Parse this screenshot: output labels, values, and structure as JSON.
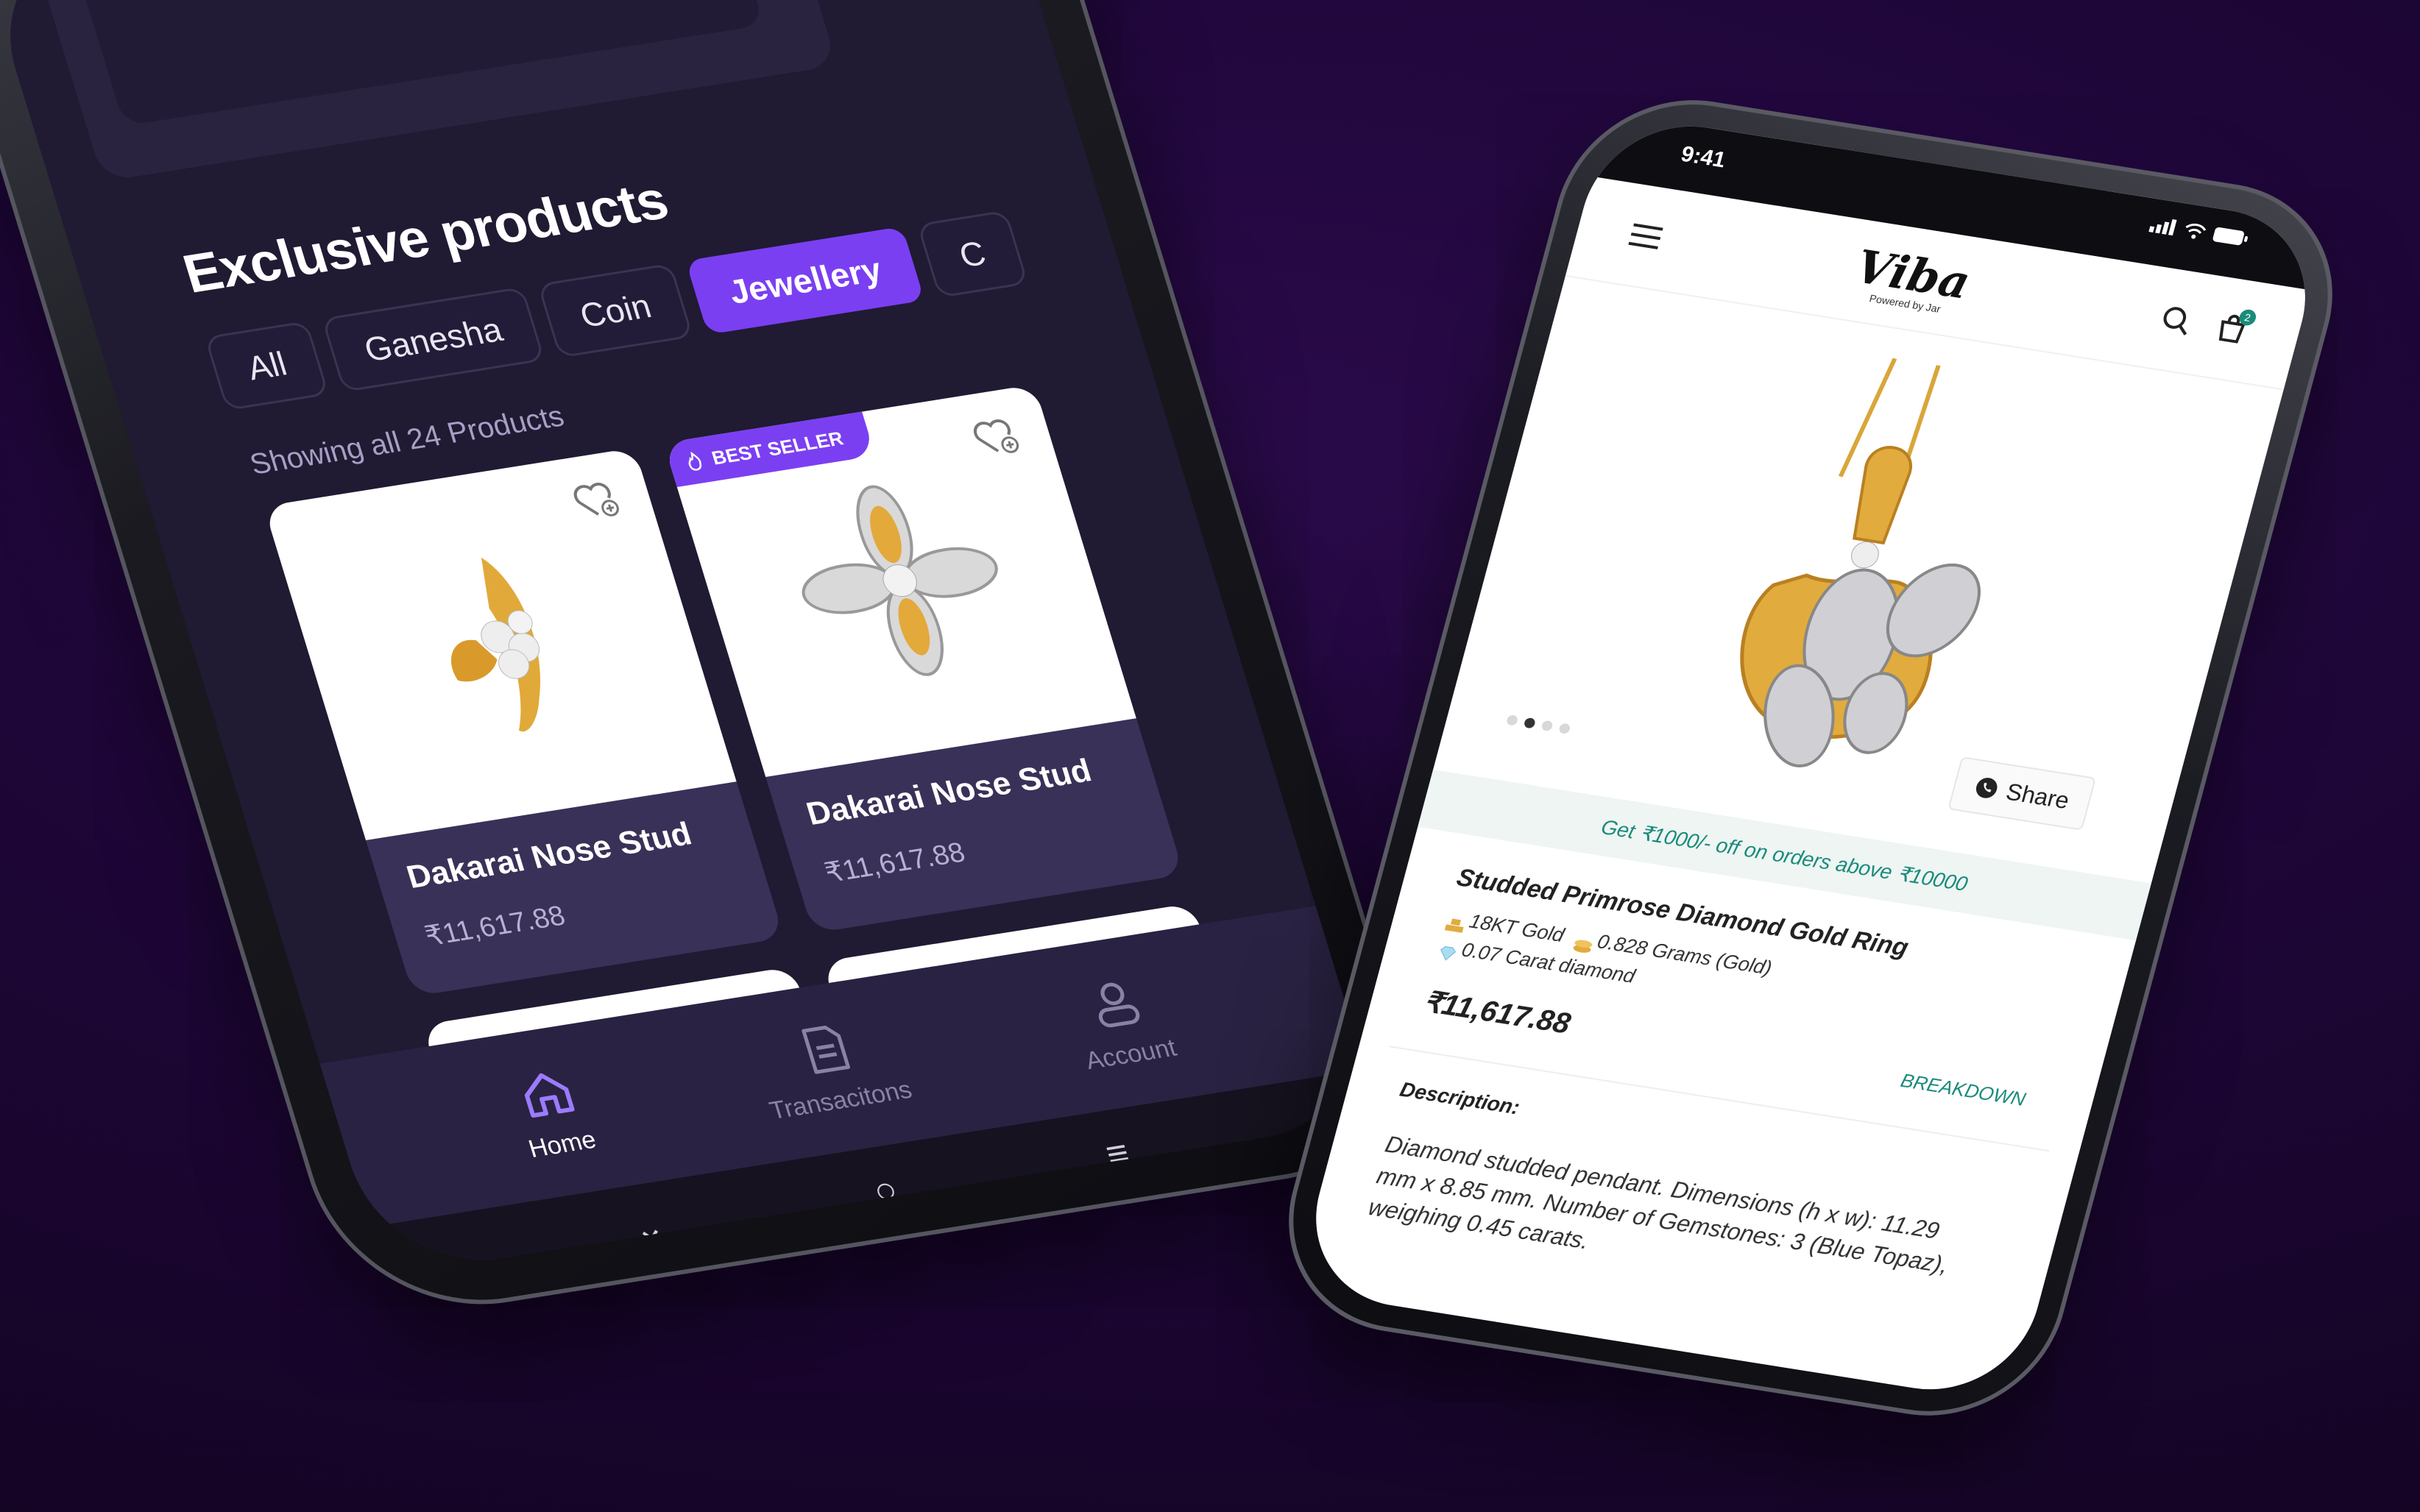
{
  "left_app": {
    "section_title": "Exclusive products",
    "tabs": [
      {
        "label": "All"
      },
      {
        "label": "Ganesha"
      },
      {
        "label": "Coin"
      },
      {
        "label": "Jewellery"
      },
      {
        "label": "C"
      }
    ],
    "active_tab": "Jewellery",
    "showing_text": "Showing all 24 Products",
    "products": [
      {
        "name": "Dakarai Nose Stud",
        "price": "₹11,617.88",
        "badge": ""
      },
      {
        "name": "Dakarai Nose Stud",
        "price": "₹11,617.88",
        "badge": "BEST SELLER"
      }
    ],
    "nav": [
      {
        "label": "Home",
        "icon": "home-icon"
      },
      {
        "label": "Transacitons",
        "icon": "document-icon"
      },
      {
        "label": "Account",
        "icon": "user-icon"
      }
    ],
    "active_nav": "Home",
    "system_nav": [
      "back-chevron-icon",
      "home-circle-icon",
      "menu-lines-icon"
    ]
  },
  "right_app": {
    "status_time": "9:41",
    "brand": "Viba",
    "powered_by": "Powered by Jar",
    "cart_count": "2",
    "carousel_dots": 4,
    "carousel_active": 2,
    "share_label": "Share",
    "offer_text": "Get ₹1000/- off on orders above ₹10000",
    "product_name": "Studded Primrose Diamond Gold Ring",
    "spec_gold": "18KT Gold",
    "spec_weight": "0.828 Grams (Gold)",
    "spec_diamond": "0.07 Carat diamond",
    "price": "₹11,617.88",
    "breakdown_label": "BREAKDOWN",
    "description_heading": "Description:",
    "description_text": "Diamond studded pendant. Dimensions (h x w): 11.29 mm x 8.85 mm. Number of Gemstones: 3 (Blue Topaz), weighing 0.45 carats."
  },
  "colors": {
    "accent_purple": "#7b3ff2",
    "teal": "#1a8b7a",
    "background": "#1e0638"
  }
}
